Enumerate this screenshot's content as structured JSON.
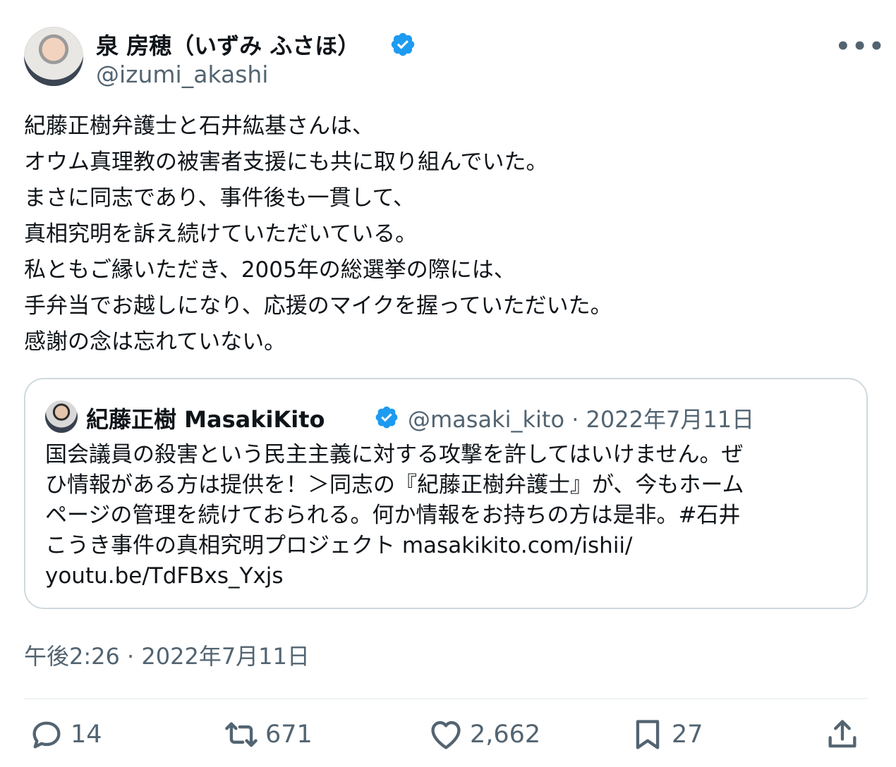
{
  "author": {
    "name": "泉 房穂（いずみ ふさほ）",
    "handle": "@izumi_akashi"
  },
  "tweet": {
    "text": "紀藤正樹弁護士と石井紘基さんは、\nオウム真理教の被害者支援にも共に取り組んでいた。\nまさに同志であり、事件後も一貫して、\n真相究明を訴え続けていただいている。\n私ともご縁いただき、2005年の総選挙の際には、\n手弁当でお越しになり、応援のマイクを握っていただいた。\n感謝の念は忘れていない。",
    "timestamp": "午後2:26 · 2022年7月11日"
  },
  "quote": {
    "name": "紀藤正樹 MasakiKito",
    "meta": "@masaki_kito · 2022年7月11日",
    "text": "国会議員の殺害という民主主義に対する攻撃を許してはいけません。ぜ\nひ情報がある方は提供を！＞同志の『紀藤正樹弁護士』が、今もホーム\nページの管理を続けておられる。何か情報をお持ちの方は是非。#石井\nこうき事件の真相究明プロジェクト masakikito.com/ishii/\nyoutu.be/TdFBxs_Yxjs"
  },
  "actions": {
    "replies": "14",
    "retweets": "671",
    "likes": "2,662",
    "bookmarks": "27"
  },
  "colors": {
    "verified": "#1d9bf0",
    "text": "#0f1419",
    "secondary": "#536471",
    "border": "#cfd9de"
  }
}
